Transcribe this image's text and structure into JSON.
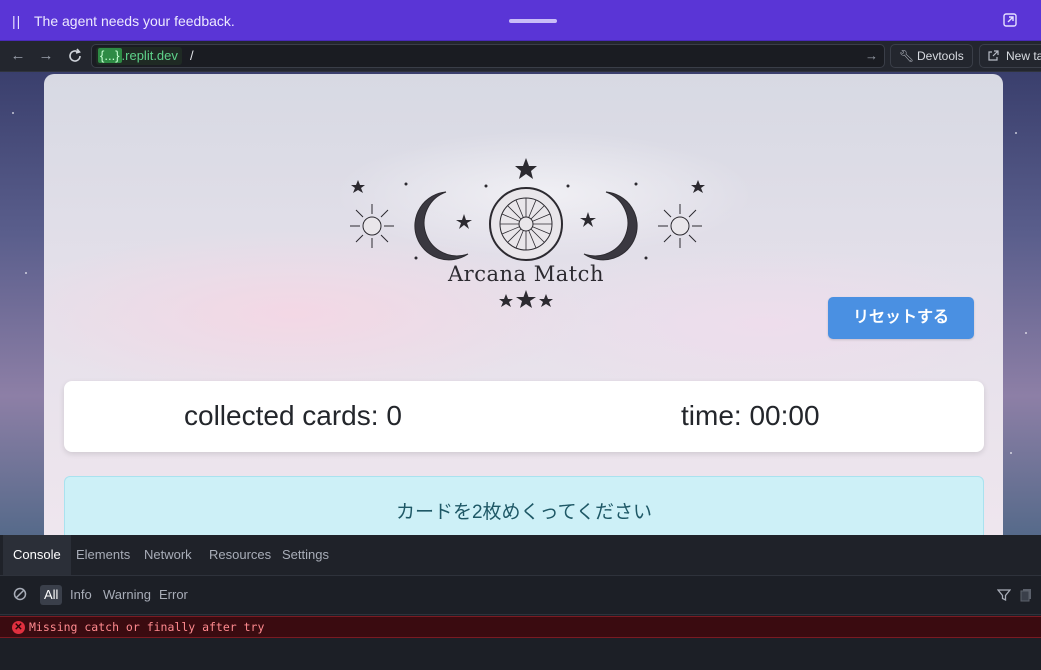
{
  "agent_bar": {
    "message": "The agent needs your feedback.",
    "pause_glyph": "||"
  },
  "url_bar": {
    "host_template": "{...}",
    "host_suffix": ".replit.dev",
    "path": "/",
    "devtools_label": "Devtools",
    "new_tab_label": "New ta"
  },
  "app": {
    "logo_title": "Arcana Match",
    "reset_label": "リセットする",
    "collected_label": "collected cards: 0",
    "time_label": "time: 00:00",
    "notice": "カードを2枚めくってください"
  },
  "devtools": {
    "tabs": [
      {
        "label": "Console",
        "active": true
      },
      {
        "label": "Elements"
      },
      {
        "label": "Network"
      },
      {
        "label": "Resources"
      },
      {
        "label": "Settings"
      }
    ],
    "filters": [
      {
        "label": "All",
        "active": true
      },
      {
        "label": "Info"
      },
      {
        "label": "Warning"
      },
      {
        "label": "Error"
      }
    ],
    "error_message": "Missing catch or finally after try"
  },
  "colors": {
    "agent_bar": "#5a35d6",
    "reset_button": "#4a90e2",
    "notice_bg": "#cdf0f7",
    "error_bg": "#3a0b10"
  },
  "icons": [
    "pause-icon",
    "drag-handle-icon",
    "popout-icon",
    "back-icon",
    "forward-icon",
    "reload-icon",
    "go-icon",
    "wrench-icon",
    "external-link-icon",
    "clear-console-icon",
    "filter-icon",
    "copy-icon",
    "error-icon"
  ]
}
